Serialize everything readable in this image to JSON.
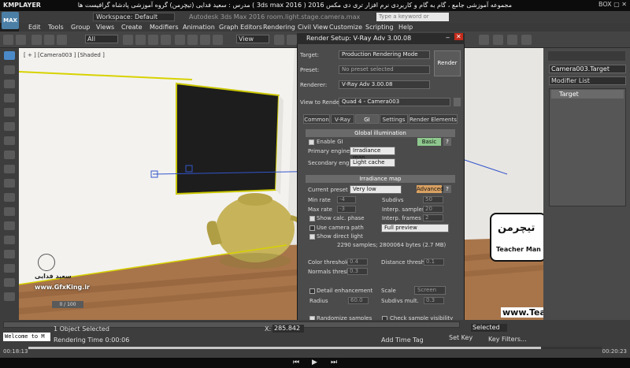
{
  "player": {
    "logo": "KMPLAYER",
    "title": "مجموعه آموزشی جامع ، گام به گام و کاربردی نرم افزار تری دی مکس 2016 ( 3ds max 2016 )   مدرس : سعید فدایی (تیچرمن) گروه آموزشی پادشاه گرافیست ها",
    "controls": "BOX ▢ ✕"
  },
  "max": {
    "logo": "MAX",
    "workspace": "Workspace: Default",
    "title": "Autodesk 3ds Max 2016    room.light.stage.camera.max",
    "search_placeholder": "Type a keyword or phrase",
    "menus": [
      "Edit",
      "Tools",
      "Group",
      "Views",
      "Create",
      "Modifiers",
      "Animation",
      "Graph Editors",
      "Rendering",
      "Civil View",
      "Customize",
      "Scripting",
      "Help"
    ],
    "selection_filter": "All",
    "ref_coord": "View"
  },
  "viewport": {
    "label": "[ + ] [Camera003 ] [Shaded ]",
    "watermark_name": "سعید فدایی",
    "watermark_site": "www.GfxKing.ir",
    "frame_counter": "0 / 100",
    "teacher_site": "www.TeacherMan.ir",
    "teacher_logo_fa": "تیچرمن",
    "teacher_logo_en": "Teacher Man"
  },
  "command_panel": {
    "object_name": "Camera003.Target",
    "modifier_list": "Modifier List",
    "stack_item": "Target"
  },
  "dialog": {
    "title": "Render Setup: V-Ray Adv 3.00.08",
    "target_label": "Target:",
    "target_value": "Production Rendering Mode",
    "preset_label": "Preset:",
    "preset_value": "No preset selected",
    "renderer_label": "Renderer:",
    "renderer_value": "V-Ray Adv 3.00.08",
    "render_button": "Render",
    "view_label": "View to Render:",
    "view_value": "Quad 4 - Camera003",
    "tabs": [
      "Common",
      "V-Ray",
      "GI",
      "Settings",
      "Render Elements"
    ],
    "gi": {
      "header": "Global illumination",
      "enable_gi": "Enable GI",
      "mode_button": "Basic",
      "primary_label": "Primary engine",
      "primary_value": "Irradiance map",
      "secondary_label": "Secondary engine",
      "secondary_value": "Light cache"
    },
    "irr": {
      "header": "Irradiance map",
      "preset_label": "Current preset",
      "preset_value": "Very low",
      "mode_button": "Advanced",
      "min_rate_label": "Min rate",
      "min_rate_value": "-4",
      "max_rate_label": "Max rate",
      "max_rate_value": "-3",
      "subdivs_label": "Subdivs",
      "subdivs_value": "50",
      "interp_samples_label": "Interp. samples",
      "interp_samples_value": "20",
      "interp_frames_label": "Interp. frames",
      "interp_frames_value": "2",
      "show_calc": "Show calc. phase",
      "use_camera": "Use camera path",
      "show_direct": "Show direct light",
      "preview_value": "Full preview",
      "samples_info": "2290 samples; 2800064 bytes (2.7 MB)",
      "color_threshold_label": "Color threshold",
      "color_threshold_value": "0.4",
      "distance_threshold_label": "Distance threshold",
      "distance_threshold_value": "0.1",
      "normals_threshold_label": "Normals threshold",
      "normals_threshold_value": "0.3",
      "detail_enh": "Detail enhancement",
      "scale_label": "Scale",
      "scale_value": "Screen",
      "radius_label": "Radius",
      "radius_value": "60.0",
      "subdivs_mult_label": "Subdivs mult.",
      "subdivs_mult_value": "0.3",
      "randomize": "Randomize samples",
      "check_visibility": "Check sample visibility"
    }
  },
  "status": {
    "welcome": "Welcome to M",
    "selected": "1 Object Selected",
    "rendering_time": "Rendering Time  0:00:06",
    "x_label": "X:",
    "x_value": "285.842",
    "add_time_tag": "Add Time Tag",
    "set_key": "Set Key",
    "key_filters": "Key Filters...",
    "selected_dd": "Selected"
  },
  "playback": {
    "elapsed": "00:18:13",
    "total": "00:20:23",
    "progress": 0.894
  }
}
